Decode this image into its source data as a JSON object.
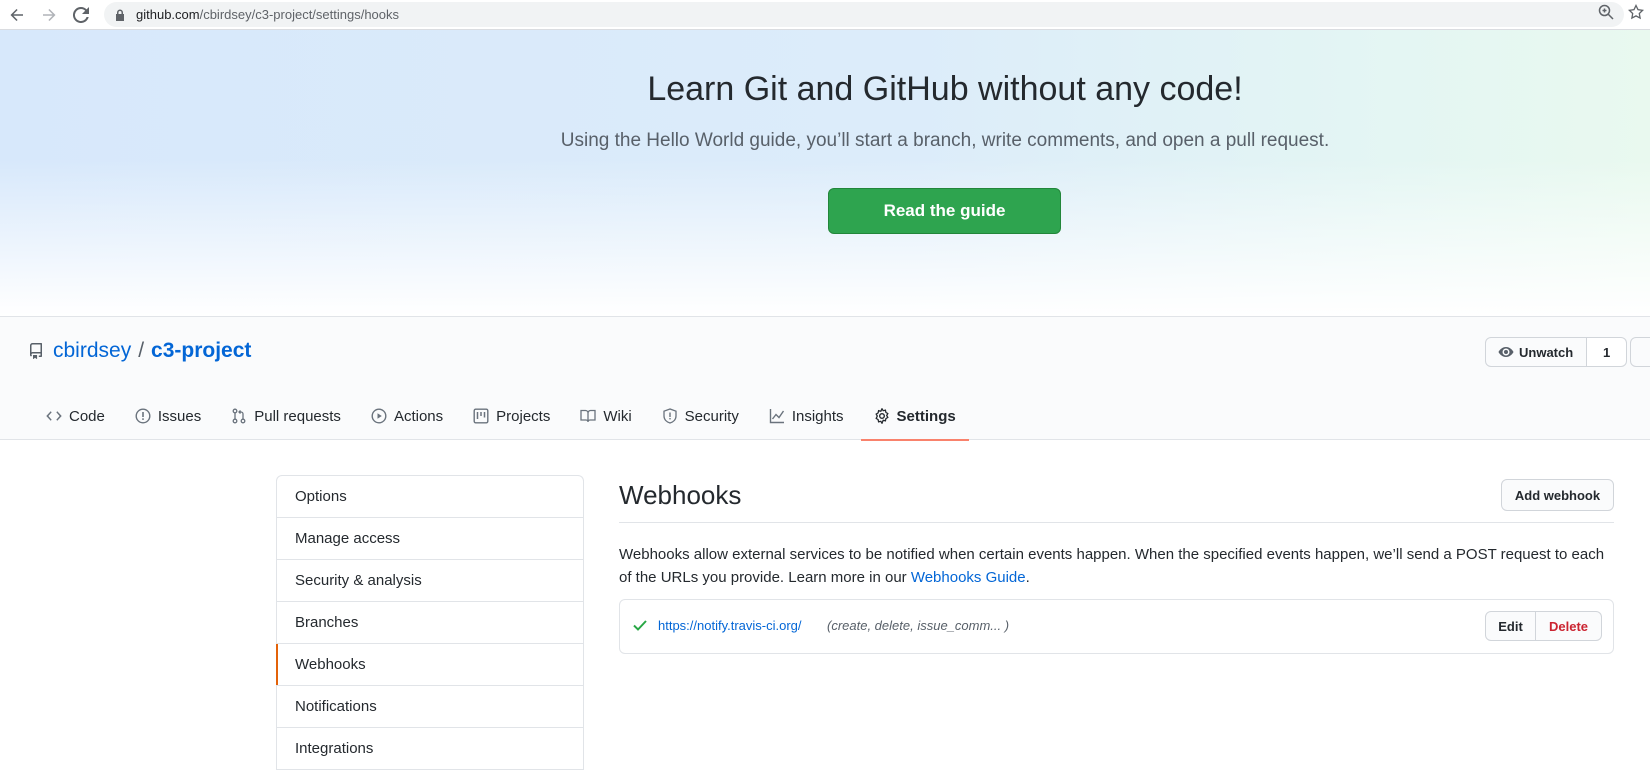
{
  "browser": {
    "url_host": "github.com",
    "url_path": "/cbirdsey/c3-project/settings/hooks"
  },
  "hero": {
    "title": "Learn Git and GitHub without any code!",
    "subtitle": "Using the Hello World guide, you’ll start a branch, write comments, and open a pull request.",
    "button_label": "Read the guide"
  },
  "repo": {
    "owner": "cbirdsey",
    "separator": "/",
    "name": "c3-project",
    "watch_label": "Unwatch",
    "watch_count": "1"
  },
  "tabs": [
    {
      "label": "Code",
      "icon": "code-icon"
    },
    {
      "label": "Issues",
      "icon": "issue-icon"
    },
    {
      "label": "Pull requests",
      "icon": "pull-request-icon"
    },
    {
      "label": "Actions",
      "icon": "play-icon"
    },
    {
      "label": "Projects",
      "icon": "project-icon"
    },
    {
      "label": "Wiki",
      "icon": "book-icon"
    },
    {
      "label": "Security",
      "icon": "shield-icon"
    },
    {
      "label": "Insights",
      "icon": "graph-icon"
    },
    {
      "label": "Settings",
      "icon": "gear-icon",
      "selected": true
    }
  ],
  "sidebar": {
    "items": [
      {
        "label": "Options"
      },
      {
        "label": "Manage access"
      },
      {
        "label": "Security & analysis"
      },
      {
        "label": "Branches"
      },
      {
        "label": "Webhooks",
        "active": true
      },
      {
        "label": "Notifications"
      },
      {
        "label": "Integrations"
      }
    ]
  },
  "webhooks": {
    "title": "Webhooks",
    "add_button": "Add webhook",
    "description": "Webhooks allow external services to be notified when certain events happen. When the specified events happen, we’ll send a POST request to each of the URLs you provide. Learn more in our ",
    "guide_link": "Webhooks Guide",
    "description_end": ".",
    "hooks": [
      {
        "url": "https://notify.travis-ci.org/",
        "events": "(create, delete, issue_comm... )",
        "status": "success",
        "edit_label": "Edit",
        "delete_label": "Delete"
      }
    ]
  },
  "colors": {
    "accent_green": "#2ea44f",
    "link_blue": "#0366d6",
    "tab_underline": "#f9826c",
    "danger_red": "#cb2431"
  }
}
